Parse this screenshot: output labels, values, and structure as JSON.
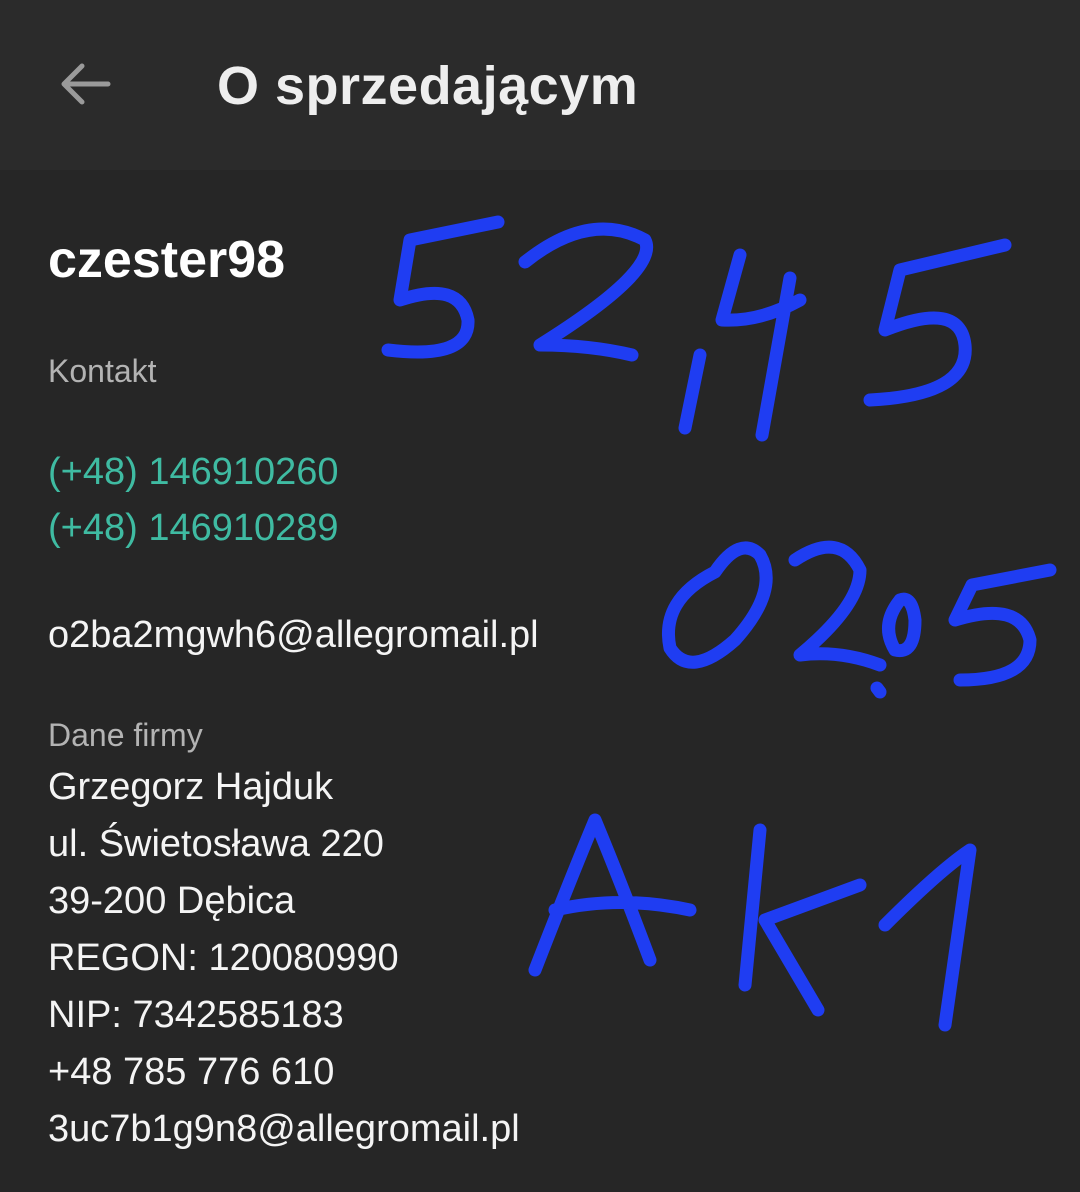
{
  "header": {
    "title": "O sprzedającym",
    "back_icon": "arrow-left-icon"
  },
  "seller": {
    "name": "czester98"
  },
  "contact": {
    "label": "Kontakt",
    "phones": [
      "(+48) 146910260",
      "(+48) 146910289"
    ],
    "email": "o2ba2mgwh6@allegromail.pl"
  },
  "company": {
    "label": "Dane firmy",
    "lines": [
      "Grzegorz Hajduk",
      "ul. Świetosława 220",
      "39-200 Dębica",
      "REGON: 120080990",
      "NIP: 7342585183",
      "+48 785 776 610",
      "3uc7b1g9n8@allegromail.pl"
    ]
  },
  "handwriting": {
    "color": "#1f3df2",
    "lines": [
      "52,45",
      "02.05",
      "AK1"
    ]
  },
  "colors": {
    "background": "#262626",
    "topbar": "#2b2b2b",
    "link_green": "#3fbba2",
    "label_gray": "#b3b3b3"
  }
}
